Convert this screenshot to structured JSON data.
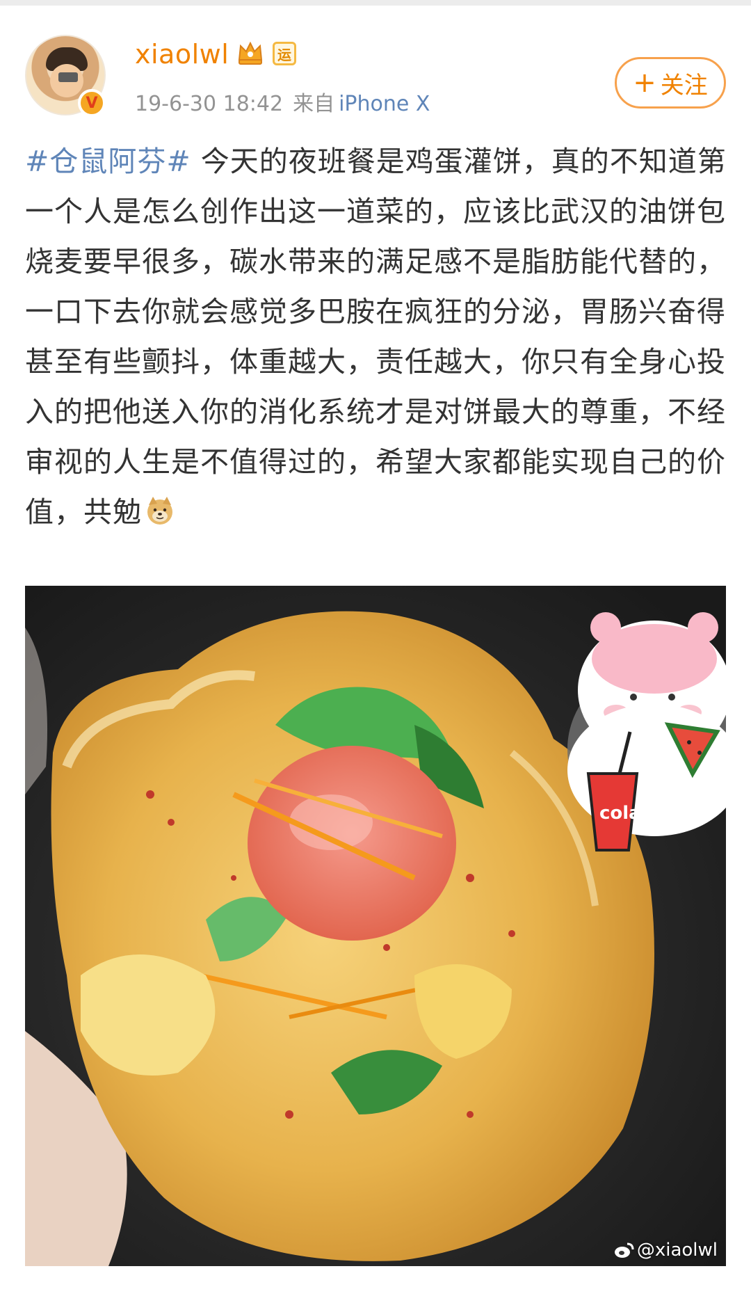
{
  "user": {
    "name": "xiaolwl",
    "verified_badge": "V",
    "badge_yun": "运"
  },
  "meta": {
    "timestamp": "19-6-30 18:42",
    "from_label": "来自",
    "device": "iPhone X"
  },
  "follow_button": {
    "plus": "+",
    "label": "关注"
  },
  "post": {
    "topic": "#仓鼠阿芬#",
    "body": " 今天的夜班餐是鸡蛋灌饼，真的不知道第一个人是怎么创作出这一道菜的，应该比武汉的油饼包烧麦要早很多，碳水带来的满足感不是脂肪能代替的，一口下去你就会感觉多巴胺在疯狂的分泌，胃肠兴奋得甚至有些颤抖，体重越大，责任越大，你只有全身心投入的把他送入你的消化系统才是对饼最大的尊重，不经审视的人生是不值得过的，希望大家都能实现自己的价值，共勉",
    "emoji": "doge-icon"
  },
  "photo": {
    "sticker_cup_text": "cola",
    "watermark": "@xiaolwl"
  },
  "colors": {
    "username": "#f08200",
    "link": "#5f85b8",
    "meta": "#939393",
    "follow_border": "#f7a14c"
  }
}
